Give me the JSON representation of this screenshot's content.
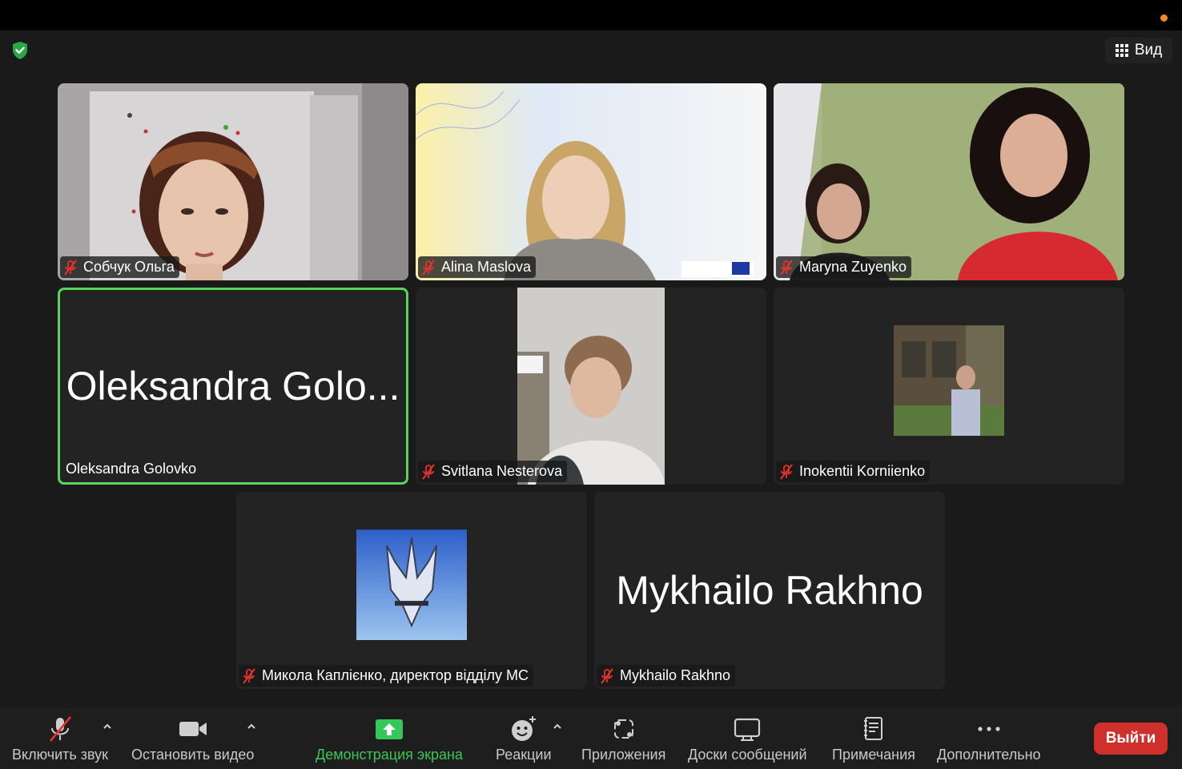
{
  "top_bar": {
    "view_label": "Вид"
  },
  "participants": [
    {
      "name": "Собчук Ольга",
      "muted": true
    },
    {
      "name": "Alina Maslova",
      "muted": true
    },
    {
      "name": "Maryna Zuyenko",
      "muted": true
    },
    {
      "name": "Oleksandra Golovko",
      "display_name": "Oleksandra Golo...",
      "muted": false,
      "speaking": true
    },
    {
      "name": "Svitlana Nesterova",
      "muted": true
    },
    {
      "name": "Inokentii Korniienko",
      "muted": true
    },
    {
      "name": "Микола Каплієнко, директор відділу МС",
      "muted": true
    },
    {
      "name": "Mykhailo Rakhno",
      "display_name": "Mykhailo Rakhno",
      "muted": true
    }
  ],
  "toolbar": {
    "unmute": "Включить звук",
    "stop_video": "Остановить видео",
    "share_screen": "Демонстрация экрана",
    "reactions": "Реакции",
    "apps": "Приложения",
    "whiteboards": "Доски сообщений",
    "notes": "Примечания",
    "more": "Дополнительно",
    "leave": "Выйти"
  },
  "colors": {
    "active_speaker_border": "#5ad35a",
    "share_green": "#34c759",
    "leave_red": "#d0302c",
    "muted_red": "#e5322d"
  }
}
